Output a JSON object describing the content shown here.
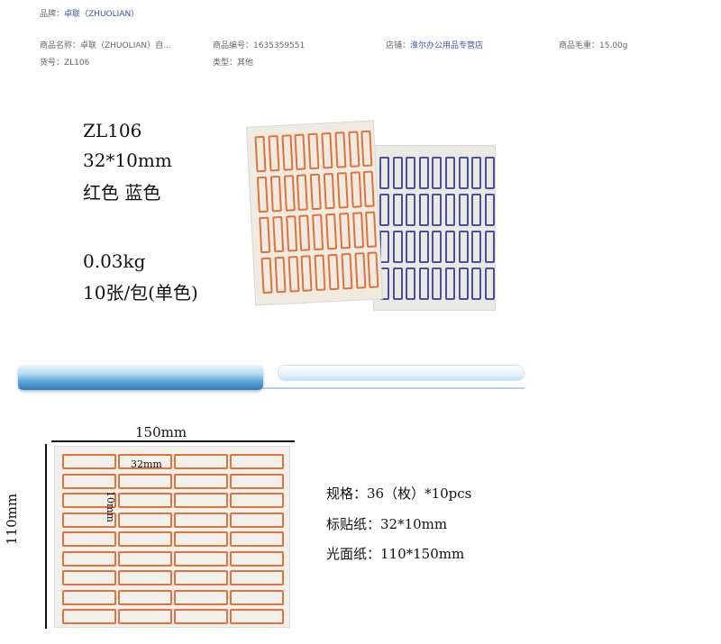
{
  "attributes": {
    "brand_label": "品牌：",
    "brand_value": "卓联（ZHUOLIAN）",
    "name": "商品名称：卓联（ZHUOLIAN）自...",
    "id": "商品编号：1635359551",
    "shop_label": "店铺：",
    "shop_value": "淮尔办公用品专营店",
    "weight": "商品毛重：15.00g",
    "sku": "货号：ZL106",
    "type": "类型：其他"
  },
  "product": {
    "model": "ZL106",
    "size": "32*10mm",
    "colors": "红色 蓝色",
    "weight": "0.03kg",
    "pack": "10张/包(单色)"
  },
  "dimensions": {
    "width": "150mm",
    "height": "110mm",
    "label_w": "32mm",
    "label_h": "10mm"
  },
  "specs": {
    "spec": "规格：36（枚）*10pcs",
    "label_paper": "标贴纸：32*10mm",
    "gloss_paper": "光面纸：110*150mm"
  },
  "colors": {
    "red": "#e0723e",
    "blue": "#4c4ea3",
    "link": "#3a56a8"
  }
}
